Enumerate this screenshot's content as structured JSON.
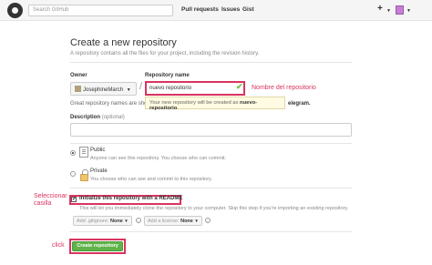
{
  "header": {
    "search_placeholder": "Search GitHub",
    "nav": [
      "Pull requests",
      "Issues",
      "Gist"
    ],
    "plus": "+"
  },
  "main": {
    "title": "Create a new repository",
    "subtitle": "A repository contains all the files for your project, including the revision history.",
    "owner_label": "Owner",
    "owner_value": "JosephineMarch",
    "slash": "/",
    "repo_label": "Repository name",
    "repo_value": "nuevo repositorio",
    "hint_text": "Great repository names are shor",
    "tooltip_prefix": "Your new repository will be created as",
    "tooltip_name": "nuevo-repositorio",
    "tooltip_suffix": ".",
    "hint_tail": "elegram.",
    "description_label": "Description",
    "description_optional": "(optional)",
    "visibility": [
      {
        "title": "Public",
        "desc": "Anyone can see this repository. You choose who can commit.",
        "selected": true
      },
      {
        "title": "Private",
        "desc": "You choose who can see and commit to this repository.",
        "selected": false
      }
    ],
    "readme_label": "Initialize this repository with a README",
    "readme_checked": true,
    "readme_check_glyph": "✔",
    "readme_desc": "This will let you immediately clone the repository to your computer. Skip this step if you're importing an existing repository.",
    "gitignore_prefix": "Add .gitignore:",
    "gitignore_value": "None",
    "license_prefix": "Add a license:",
    "license_value": "None",
    "info_glyph": "i",
    "create_label": "Create repository"
  },
  "annotations": {
    "repo_name": "Nombre del repositorio",
    "select_line1": "Seleccionar",
    "select_line2": "casilla",
    "click": "click"
  },
  "colors": {
    "annotation": "#d9345f",
    "create_button": "#5fb34a",
    "check": "#6cc644"
  }
}
